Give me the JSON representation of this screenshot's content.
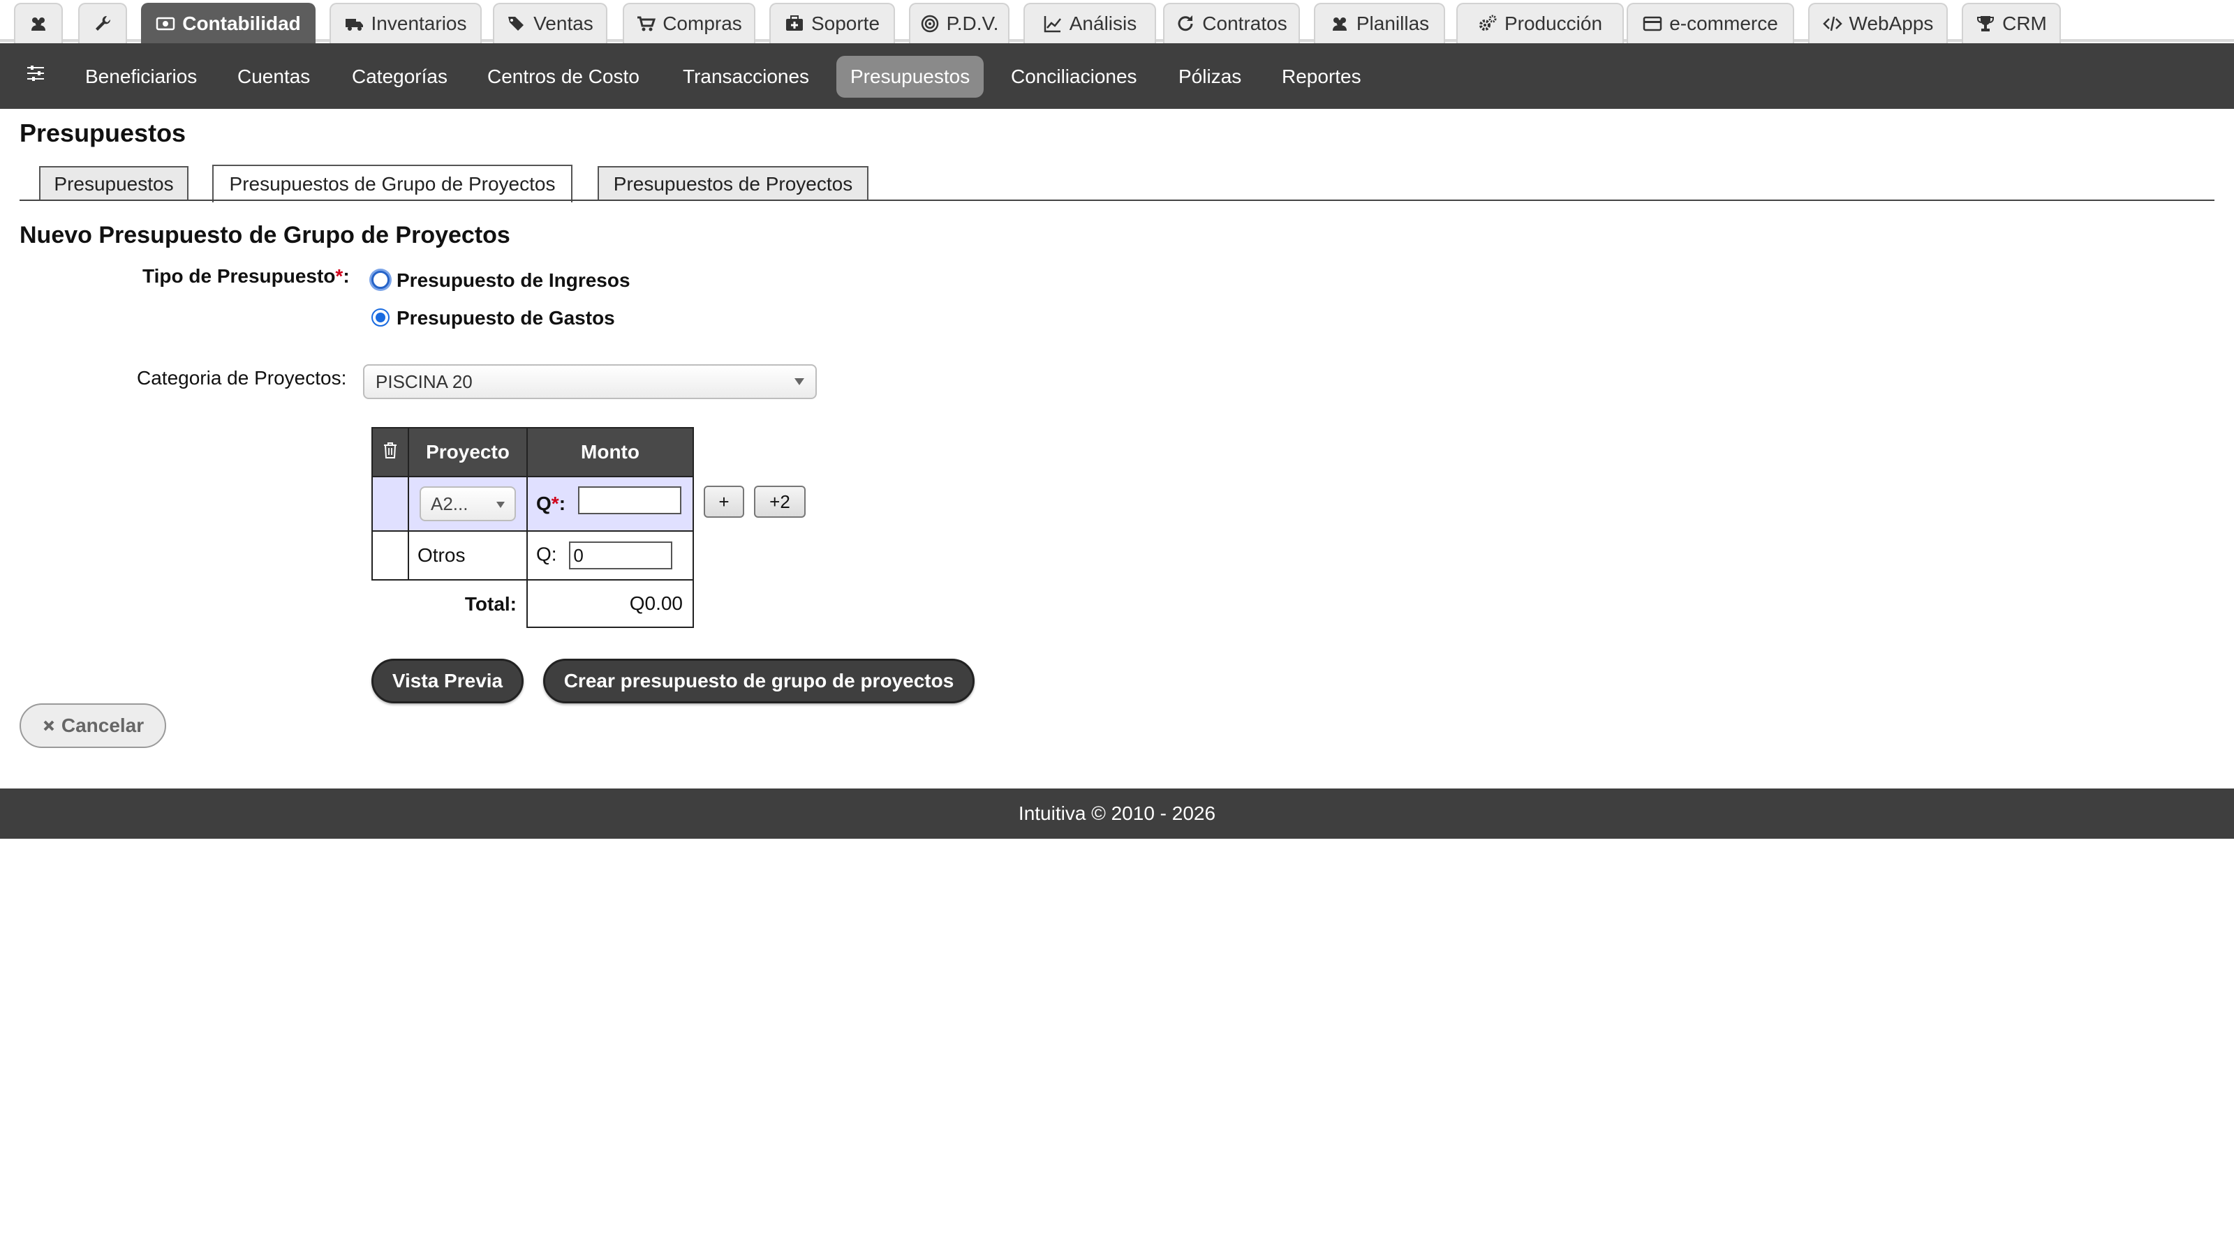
{
  "modules": [
    {
      "label": "",
      "icon": "users-icon"
    },
    {
      "label": "",
      "icon": "wrench-icon"
    },
    {
      "label": "Contabilidad",
      "icon": "money-icon",
      "active": true
    },
    {
      "label": "Inventarios",
      "icon": "truck-icon"
    },
    {
      "label": "Ventas",
      "icon": "tags-icon"
    },
    {
      "label": "Compras",
      "icon": "cart-icon"
    },
    {
      "label": "Soporte",
      "icon": "medkit-icon"
    },
    {
      "label": "P.D.V.",
      "icon": "bullseye-icon"
    },
    {
      "label": "Análisis",
      "icon": "chart-line-icon"
    },
    {
      "label": "Contratos",
      "icon": "refresh-icon"
    },
    {
      "label": "Planillas",
      "icon": "users-icon"
    },
    {
      "label": "Producción",
      "icon": "cogs-icon"
    },
    {
      "label": "e-commerce",
      "icon": "credit-card-icon"
    },
    {
      "label": "WebApps",
      "icon": "code-icon"
    },
    {
      "label": "CRM",
      "icon": "trophy-icon"
    }
  ],
  "subnav": [
    "Beneficiarios",
    "Cuentas",
    "Categorías",
    "Centros de Costo",
    "Transacciones",
    "Presupuestos",
    "Conciliaciones",
    "Pólizas",
    "Reportes"
  ],
  "page_title": "Presupuestos",
  "content_tabs": [
    "Presupuestos",
    "Presupuestos de Grupo de Proyectos",
    "Presupuestos de Proyectos"
  ],
  "section_title": "Nuevo Presupuesto de Grupo de Proyectos",
  "form": {
    "type_label": "Tipo de Presupuesto",
    "required_mark": "*",
    "colon": ":",
    "radio_income": "Presupuesto de Ingresos",
    "radio_expense": "Presupuesto de Gastos",
    "category_label": "Categoria de Proyectos:",
    "category_value": "PISCINA 20"
  },
  "table": {
    "col_project": "Proyecto",
    "col_amount": "Monto",
    "row1_project": "A2...",
    "row1_currency": "Q",
    "row1_value": "",
    "row2_project": "Otros",
    "row2_currency": "Q:",
    "row2_value": "0",
    "total_label": "Total:",
    "total_value": "Q0.00"
  },
  "buttons": {
    "add": "+",
    "add_two": "+2",
    "preview": "Vista Previa",
    "create": "Crear presupuesto de grupo de proyectos",
    "cancel": "Cancelar"
  },
  "footer": "Intuitiva © 2010 - 2026",
  "colors": {
    "dark_bar": "#3f3f3f",
    "active_tab": "#5d5d5d",
    "row_highlight": "#e0e0ff",
    "required": "#d0021b"
  }
}
